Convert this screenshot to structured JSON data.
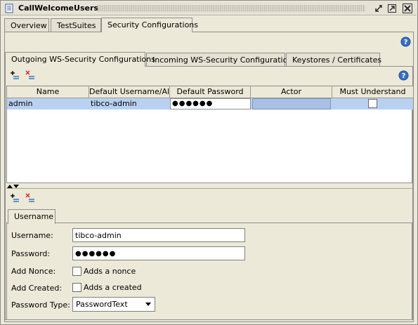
{
  "window": {
    "title": "CallWelcomeUsers"
  },
  "top_tabs": [
    {
      "label": "Overview",
      "selected": false
    },
    {
      "label": "TestSuites",
      "selected": false
    },
    {
      "label": "Security Configurations",
      "selected": true
    }
  ],
  "security_tabs": [
    {
      "label": "Outgoing WS-Security Configurations",
      "selected": true
    },
    {
      "label": "Incoming WS-Security Configurations",
      "selected": false
    },
    {
      "label": "Keystores / Certificates",
      "selected": false
    }
  ],
  "table": {
    "columns": [
      "Name",
      "Default Username/Alias",
      "Default Password",
      "Actor",
      "Must Understand"
    ],
    "rows": [
      {
        "name": "admin",
        "username": "tibco-admin",
        "password": "●●●●●●",
        "actor": "",
        "must_understand": false
      }
    ]
  },
  "entry_tabs": [
    {
      "label": "Username",
      "selected": true
    }
  ],
  "form": {
    "username_label": "Username:",
    "username_value": "tibco-admin",
    "password_label": "Password:",
    "password_value": "●●●●●●",
    "add_nonce_label": "Add Nonce:",
    "add_nonce_checkbox_label": "Adds a nonce",
    "add_created_label": "Add Created:",
    "add_created_checkbox_label": "Adds a created",
    "password_type_label": "Password Type:",
    "password_type_value": "PasswordText"
  },
  "colors": {
    "selected_row": "#b9d1f0",
    "panel_bg": "#ece9d8",
    "help_icon": "#3a6fc4"
  },
  "icons": [
    "document-icon",
    "minimize-icon",
    "maximize-icon",
    "close-icon",
    "help-icon",
    "add-icon",
    "remove-icon",
    "splitter-arrows-icon"
  ]
}
